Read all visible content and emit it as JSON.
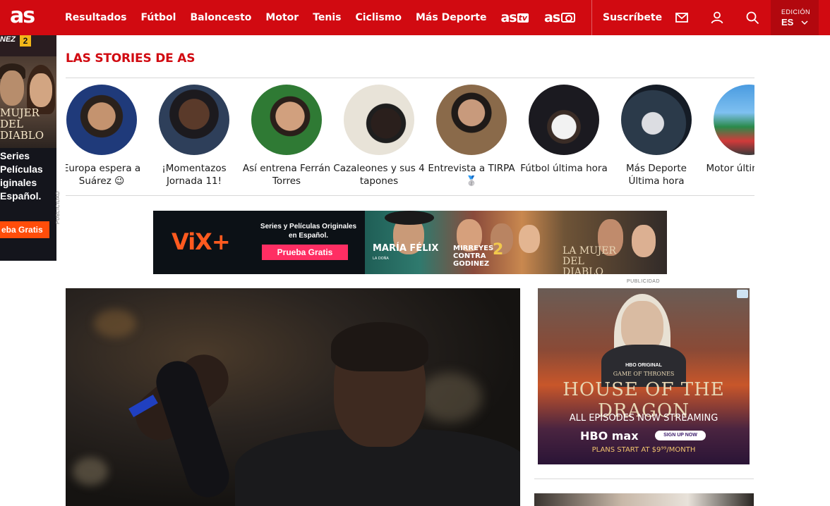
{
  "header": {
    "logo": "as",
    "nav": [
      "Resultados",
      "Fútbol",
      "Baloncesto",
      "Motor",
      "Tenis",
      "Ciclismo",
      "Más Deporte"
    ],
    "brands": [
      {
        "text": "as",
        "tag": "tv"
      },
      {
        "text": "as"
      }
    ],
    "subscribe": "Suscríbete",
    "edition_label": "EDICIÓN",
    "edition_value": "ES",
    "brand_color": "#d10a11"
  },
  "side_ad": {
    "top_text": "NEZ",
    "badge": "2",
    "title": "MUJER DEL DIABLO",
    "copy": "Series\nPelículas\niginales\nEspañol.",
    "cta": "eba Gratis",
    "publicidad": "PUBLICIDAD"
  },
  "stories": {
    "title": "LAS STORIES DE AS",
    "items": [
      {
        "label": "Europa espera a Suárez 😉"
      },
      {
        "label": "¡Momentazos Jornada 11!"
      },
      {
        "label": "Así entrena Ferrán Torres"
      },
      {
        "label": "Cazaleones y sus 4 tapones"
      },
      {
        "label": "Entrevista a TIRPA 🥈"
      },
      {
        "label": "Fútbol última hora"
      },
      {
        "label": "Más Deporte Última hora"
      },
      {
        "label": "Motor última hora"
      }
    ]
  },
  "banner_ad": {
    "brand": "ViX+",
    "copy": "Series y Películas Originales en Español.",
    "cta": "Prueba Gratis",
    "show1": "MARÍA FÉLIX",
    "show1_sub": "LA DOÑA",
    "show2": "MIRREYES CONTRA GODINEZ",
    "show2_num": "2",
    "show3": "LA MUJER DEL DIABLO",
    "publicidad": "PUBLICIDAD"
  },
  "right_ad": {
    "hbo_original": "HBO ORIGINAL",
    "got": "GAME OF THRONES",
    "title": "HOUSE OF THE DRAGON",
    "episodes": "ALL EPISODES NOW STREAMING",
    "brand": "HBO max",
    "cta": "SIGN UP NOW",
    "plans": "PLANS START AT $9⁹⁹/MONTH"
  }
}
